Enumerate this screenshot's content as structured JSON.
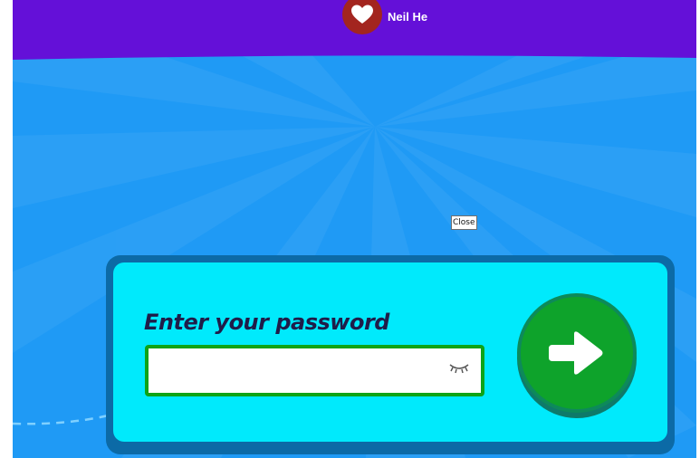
{
  "header": {
    "user_name": "Neil He",
    "avatar_icon": "heart-icon",
    "banner_color": "#6410d8"
  },
  "overlay": {
    "close_label": "Close"
  },
  "login": {
    "prompt": "Enter your password",
    "password_value": "",
    "visibility_icon": "eye-closed-icon",
    "submit_icon": "arrow-right-icon"
  },
  "colors": {
    "background": "#1f9af5",
    "card_fill": "#00eafc",
    "card_border": "#0c6aa6",
    "field_border": "#0ea316",
    "submit_fill": "#0ea32b",
    "prompt_text": "#1f1d49"
  }
}
